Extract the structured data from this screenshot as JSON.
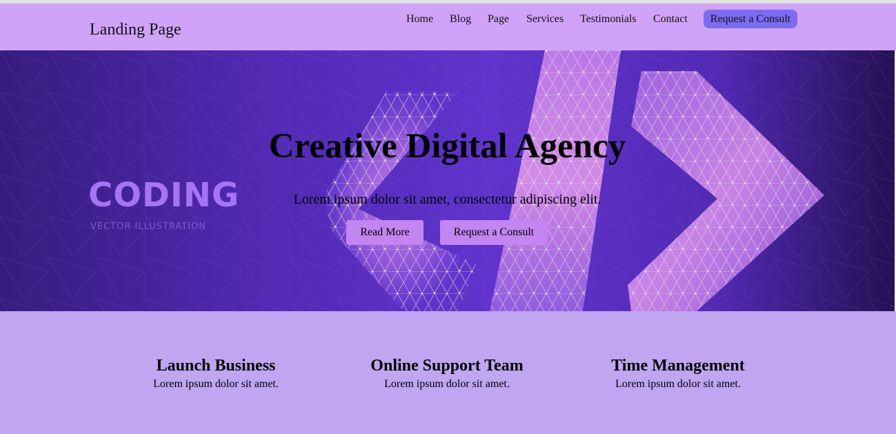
{
  "header": {
    "brand": "Landing Page",
    "nav": [
      {
        "label": "Home"
      },
      {
        "label": "Blog"
      },
      {
        "label": "Page"
      },
      {
        "label": "Services"
      },
      {
        "label": "Testimonials"
      },
      {
        "label": "Contact"
      }
    ],
    "cta_label": "Request a Consult"
  },
  "hero": {
    "title": "Creative Digital Agency",
    "subtitle": "Lorem ipsum dolor sit amet, consectetur adipiscing elit.",
    "read_more_label": "Read More",
    "consult_label": "Request a Consult",
    "image_word": "CODING",
    "image_caption": "VECTOR ILLUSTRATION"
  },
  "features": [
    {
      "title": "Launch Business",
      "text": "Lorem ipsum dolor sit amet."
    },
    {
      "title": "Online Support Team",
      "text": "Lorem ipsum dolor sit amet."
    },
    {
      "title": "Time Management",
      "text": "Lorem ipsum dolor sit amet."
    }
  ],
  "colors": {
    "navbar_bg": "#cfa3f7",
    "nav_cta_bg": "#7b6cf2",
    "hero_button_bg": "#c385ef",
    "features_bg": "#c0a5f0",
    "hero_purple": "#5a2fc4"
  }
}
